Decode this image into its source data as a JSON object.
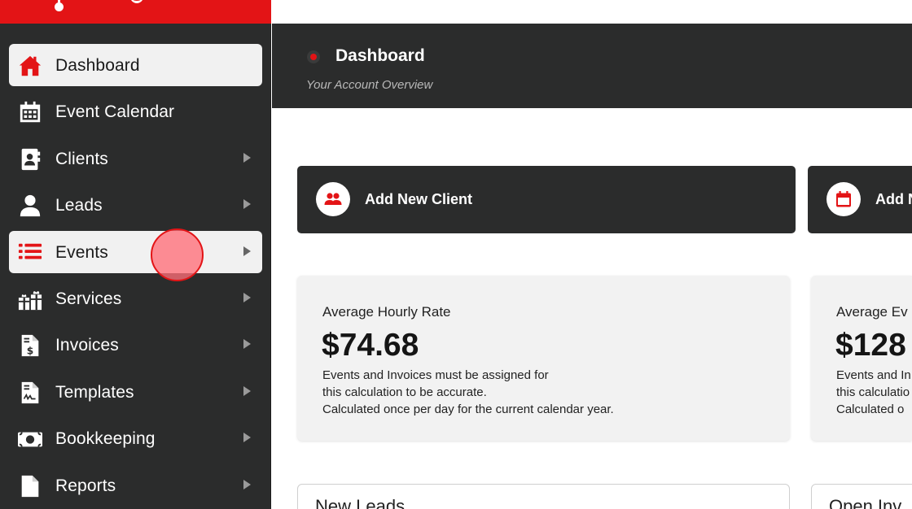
{
  "sidebar": {
    "items": [
      {
        "label": "Dashboard",
        "icon": "home-icon",
        "active": true,
        "arrow": false
      },
      {
        "label": "Event Calendar",
        "icon": "calendar-icon",
        "active": false,
        "arrow": false
      },
      {
        "label": "Clients",
        "icon": "contact-card-icon",
        "active": false,
        "arrow": true
      },
      {
        "label": "Leads",
        "icon": "user-icon",
        "active": false,
        "arrow": true
      },
      {
        "label": "Events",
        "icon": "list-icon",
        "active": false,
        "arrow": true
      },
      {
        "label": "Services",
        "icon": "gifts-icon",
        "active": false,
        "arrow": true
      },
      {
        "label": "Invoices",
        "icon": "invoice-dollar-icon",
        "active": false,
        "arrow": true
      },
      {
        "label": "Templates",
        "icon": "document-signature-icon",
        "active": false,
        "arrow": true
      },
      {
        "label": "Bookkeeping",
        "icon": "money-bill-icon",
        "active": false,
        "arrow": true
      },
      {
        "label": "Reports",
        "icon": "file-icon",
        "active": false,
        "arrow": true
      }
    ]
  },
  "header": {
    "title": "Dashboard",
    "subtitle": "Your Account Overview"
  },
  "actions": [
    {
      "label": "Add New Client",
      "icon": "users-icon"
    },
    {
      "label": "Add N",
      "icon": "calendar-add-icon"
    }
  ],
  "stats": [
    {
      "title": "Average Hourly Rate",
      "value": "$74.68",
      "note": [
        "Events and Invoices must be assigned for",
        "this calculation to be accurate.",
        "Calculated once per day for the current calendar year."
      ]
    },
    {
      "title": "Average Ev",
      "value": "$128",
      "note": [
        "Events and In",
        "this calculatio",
        "Calculated o"
      ]
    }
  ],
  "panels": [
    {
      "title": "New Leads"
    },
    {
      "title": "Open Inv"
    }
  ],
  "colors": {
    "brand_red": "#e31416",
    "dark": "#2b2c2c",
    "card_bg": "#f2f2f2"
  }
}
